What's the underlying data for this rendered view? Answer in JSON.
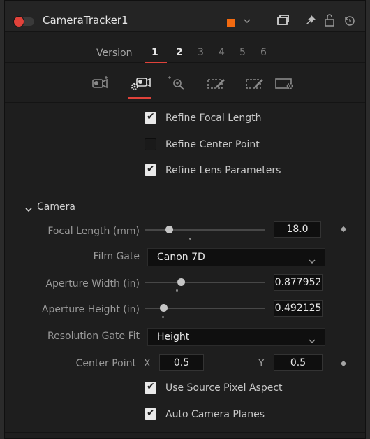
{
  "header": {
    "node_name": "CameraTracker1",
    "color_chip": "#f26a10",
    "icons": [
      "chevron-down-icon",
      "view-icon",
      "pin-icon",
      "lock-icon",
      "reset-icon"
    ]
  },
  "versions": {
    "label": "Version",
    "items": [
      "1",
      "2",
      "3",
      "4",
      "5",
      "6"
    ],
    "active": "1"
  },
  "tabs": [
    "track-tab",
    "solve-tab",
    "export-tab",
    "options-tab-1",
    "options-tab-2",
    "matte-tab"
  ],
  "refine": {
    "focal_length": {
      "label": "Refine Focal Length",
      "checked": true
    },
    "center_point": {
      "label": "Refine Center Point",
      "checked": false
    },
    "lens_parameters": {
      "label": "Refine Lens Parameters",
      "checked": true
    }
  },
  "camera": {
    "section_label": "Camera",
    "focal_length": {
      "label": "Focal Length (mm)",
      "value": "18.0"
    },
    "film_gate": {
      "label": "Film Gate",
      "value": "Canon 7D"
    },
    "aperture_width": {
      "label": "Aperture Width (in)",
      "value": "0.877952"
    },
    "aperture_height": {
      "label": "Aperture Height (in)",
      "value": "0.492125"
    },
    "resolution_gate_fit": {
      "label": "Resolution Gate Fit",
      "value": "Height"
    },
    "center_point": {
      "label": "Center Point",
      "x_label": "X",
      "x_value": "0.5",
      "y_label": "Y",
      "y_value": "0.5"
    },
    "use_source_pixel_aspect": {
      "label": "Use Source Pixel Aspect",
      "checked": true
    },
    "auto_camera_planes": {
      "label": "Auto Camera Planes",
      "checked": true
    }
  },
  "accent_color": "#e0423a"
}
